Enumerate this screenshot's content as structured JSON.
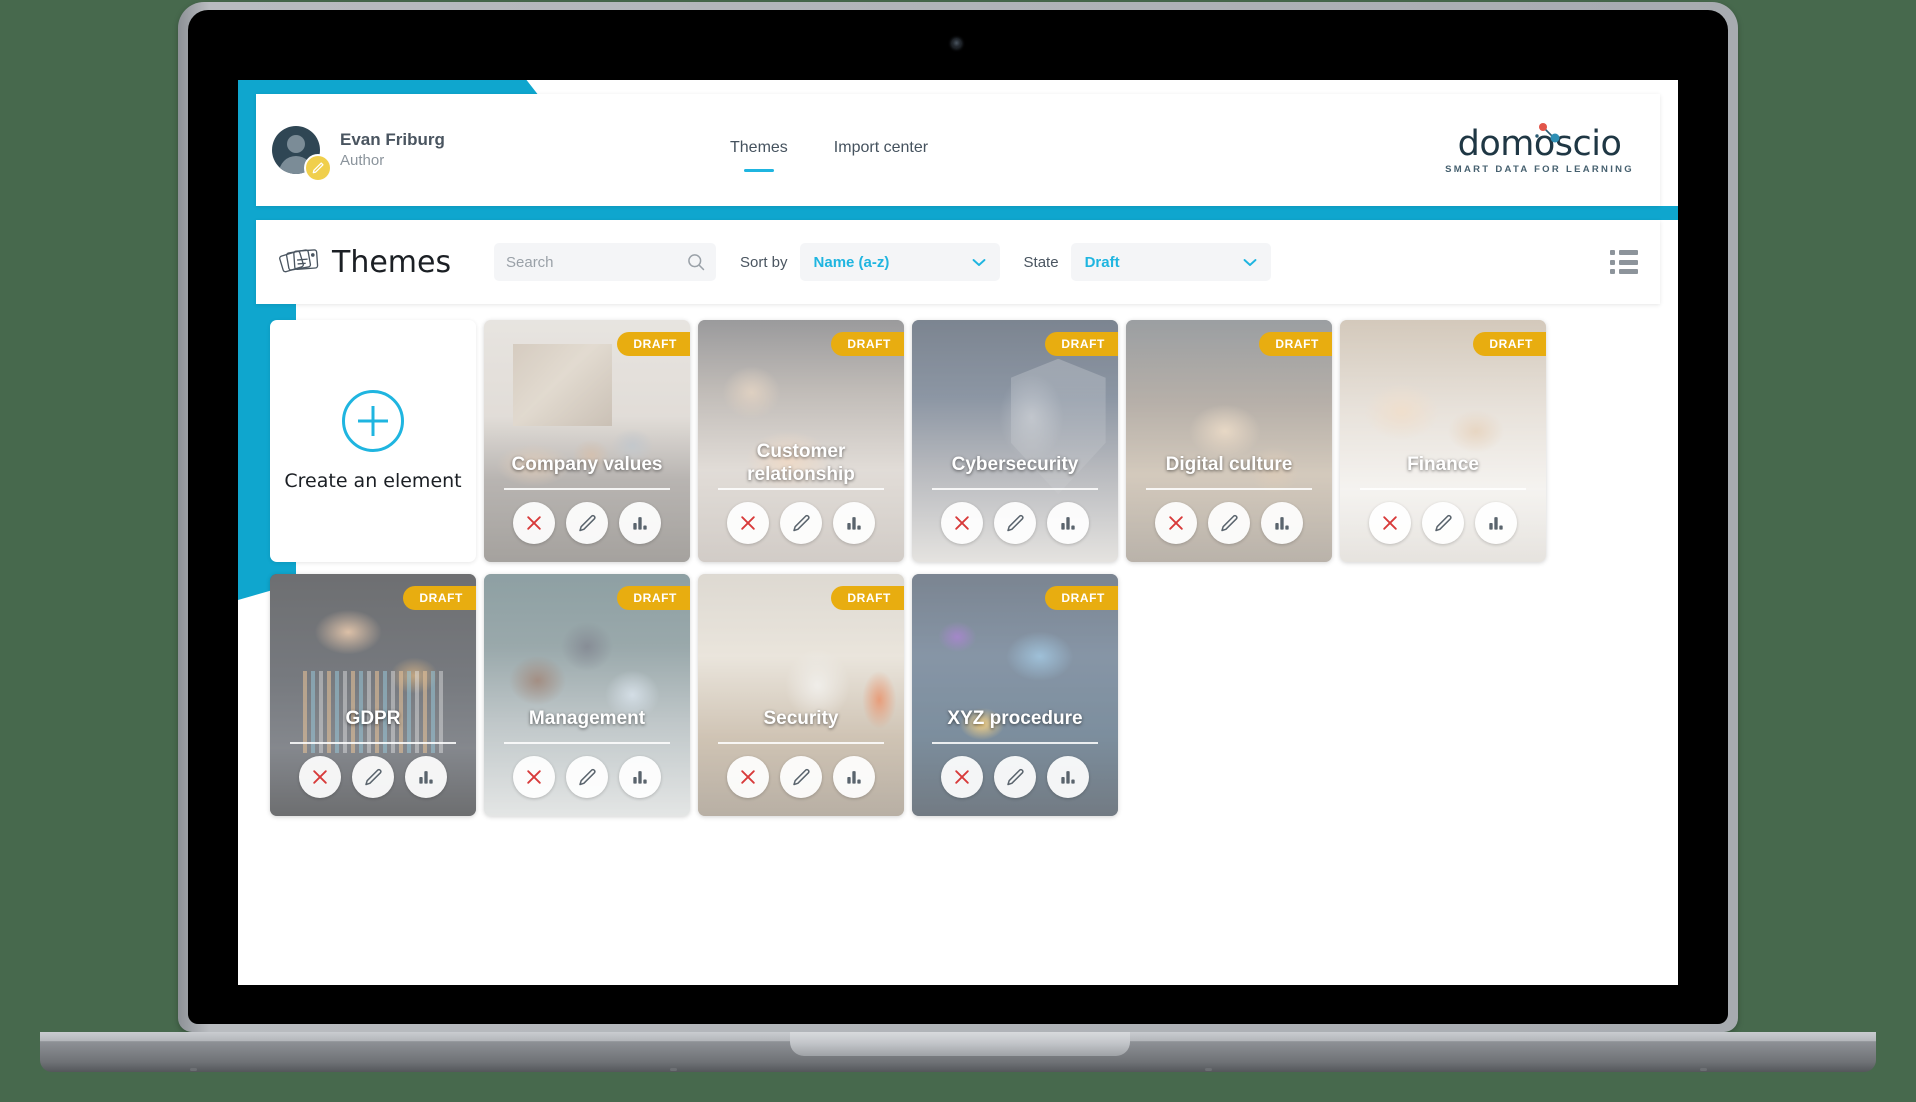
{
  "header": {
    "user": {
      "name": "Evan Friburg",
      "role": "Author"
    },
    "nav": [
      {
        "label": "Themes",
        "active": true
      },
      {
        "label": "Import center",
        "active": false
      }
    ],
    "logo": {
      "word": "domoscio",
      "tagline": "SMART DATA FOR LEARNING"
    }
  },
  "toolbar": {
    "page_title": "Themes",
    "search": {
      "value": "",
      "placeholder": "Search"
    },
    "sort": {
      "label": "Sort by",
      "value": "Name (a-z)"
    },
    "state": {
      "label": "State",
      "value": "Draft"
    },
    "view_mode": "list-view"
  },
  "create_card": {
    "label": "Create an element"
  },
  "cards": [
    {
      "title": "Company values",
      "badge": "DRAFT",
      "art": "bg-company",
      "two_line": false
    },
    {
      "title": "Customer relationship",
      "badge": "DRAFT",
      "art": "bg-customer",
      "two_line": true
    },
    {
      "title": "Cybersecurity",
      "badge": "DRAFT",
      "art": "bg-cyber",
      "two_line": false
    },
    {
      "title": "Digital culture",
      "badge": "DRAFT",
      "art": "bg-digital",
      "two_line": false
    },
    {
      "title": "Finance",
      "badge": "DRAFT",
      "art": "bg-finance",
      "two_line": false
    },
    {
      "title": "GDPR",
      "badge": "DRAFT",
      "art": "bg-gdpr",
      "two_line": false
    },
    {
      "title": "Management",
      "badge": "DRAFT",
      "art": "bg-management",
      "two_line": false
    },
    {
      "title": "Security",
      "badge": "DRAFT",
      "art": "bg-security",
      "two_line": false
    },
    {
      "title": "XYZ procedure",
      "badge": "DRAFT",
      "art": "bg-xyz",
      "two_line": false
    }
  ],
  "card_actions": [
    {
      "name": "delete-icon",
      "glyph": "close"
    },
    {
      "name": "edit-icon",
      "glyph": "pencil"
    },
    {
      "name": "stats-icon",
      "glyph": "bars"
    }
  ],
  "colors": {
    "accent_cyan": "#1FB5E0",
    "accent_cyan_dark": "#0FA6CE",
    "badge_amber": "#E8AD10",
    "delete_red": "#D83A3A",
    "text_dark": "#1B1F24",
    "text_muted": "#8B949C",
    "page_bg": "#47694D"
  }
}
